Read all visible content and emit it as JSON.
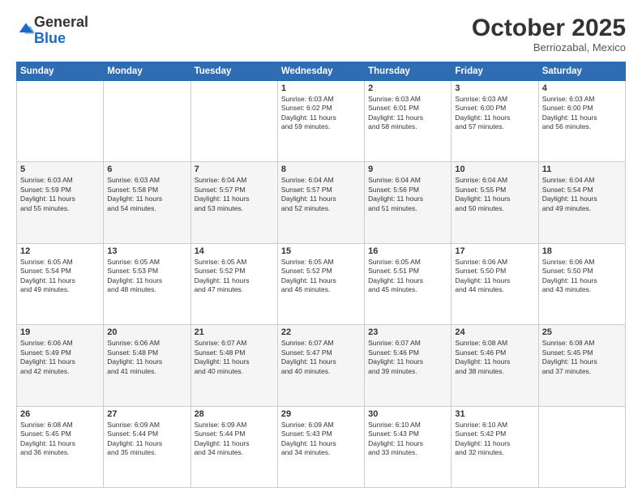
{
  "header": {
    "logo_general": "General",
    "logo_blue": "Blue",
    "month": "October 2025",
    "location": "Berriozabal, Mexico"
  },
  "days_of_week": [
    "Sunday",
    "Monday",
    "Tuesday",
    "Wednesday",
    "Thursday",
    "Friday",
    "Saturday"
  ],
  "weeks": [
    [
      {
        "day": "",
        "info": ""
      },
      {
        "day": "",
        "info": ""
      },
      {
        "day": "",
        "info": ""
      },
      {
        "day": "1",
        "info": "Sunrise: 6:03 AM\nSunset: 6:02 PM\nDaylight: 11 hours\nand 59 minutes."
      },
      {
        "day": "2",
        "info": "Sunrise: 6:03 AM\nSunset: 6:01 PM\nDaylight: 11 hours\nand 58 minutes."
      },
      {
        "day": "3",
        "info": "Sunrise: 6:03 AM\nSunset: 6:00 PM\nDaylight: 11 hours\nand 57 minutes."
      },
      {
        "day": "4",
        "info": "Sunrise: 6:03 AM\nSunset: 6:00 PM\nDaylight: 11 hours\nand 56 minutes."
      }
    ],
    [
      {
        "day": "5",
        "info": "Sunrise: 6:03 AM\nSunset: 5:59 PM\nDaylight: 11 hours\nand 55 minutes."
      },
      {
        "day": "6",
        "info": "Sunrise: 6:03 AM\nSunset: 5:58 PM\nDaylight: 11 hours\nand 54 minutes."
      },
      {
        "day": "7",
        "info": "Sunrise: 6:04 AM\nSunset: 5:57 PM\nDaylight: 11 hours\nand 53 minutes."
      },
      {
        "day": "8",
        "info": "Sunrise: 6:04 AM\nSunset: 5:57 PM\nDaylight: 11 hours\nand 52 minutes."
      },
      {
        "day": "9",
        "info": "Sunrise: 6:04 AM\nSunset: 5:56 PM\nDaylight: 11 hours\nand 51 minutes."
      },
      {
        "day": "10",
        "info": "Sunrise: 6:04 AM\nSunset: 5:55 PM\nDaylight: 11 hours\nand 50 minutes."
      },
      {
        "day": "11",
        "info": "Sunrise: 6:04 AM\nSunset: 5:54 PM\nDaylight: 11 hours\nand 49 minutes."
      }
    ],
    [
      {
        "day": "12",
        "info": "Sunrise: 6:05 AM\nSunset: 5:54 PM\nDaylight: 11 hours\nand 49 minutes."
      },
      {
        "day": "13",
        "info": "Sunrise: 6:05 AM\nSunset: 5:53 PM\nDaylight: 11 hours\nand 48 minutes."
      },
      {
        "day": "14",
        "info": "Sunrise: 6:05 AM\nSunset: 5:52 PM\nDaylight: 11 hours\nand 47 minutes."
      },
      {
        "day": "15",
        "info": "Sunrise: 6:05 AM\nSunset: 5:52 PM\nDaylight: 11 hours\nand 46 minutes."
      },
      {
        "day": "16",
        "info": "Sunrise: 6:05 AM\nSunset: 5:51 PM\nDaylight: 11 hours\nand 45 minutes."
      },
      {
        "day": "17",
        "info": "Sunrise: 6:06 AM\nSunset: 5:50 PM\nDaylight: 11 hours\nand 44 minutes."
      },
      {
        "day": "18",
        "info": "Sunrise: 6:06 AM\nSunset: 5:50 PM\nDaylight: 11 hours\nand 43 minutes."
      }
    ],
    [
      {
        "day": "19",
        "info": "Sunrise: 6:06 AM\nSunset: 5:49 PM\nDaylight: 11 hours\nand 42 minutes."
      },
      {
        "day": "20",
        "info": "Sunrise: 6:06 AM\nSunset: 5:48 PM\nDaylight: 11 hours\nand 41 minutes."
      },
      {
        "day": "21",
        "info": "Sunrise: 6:07 AM\nSunset: 5:48 PM\nDaylight: 11 hours\nand 40 minutes."
      },
      {
        "day": "22",
        "info": "Sunrise: 6:07 AM\nSunset: 5:47 PM\nDaylight: 11 hours\nand 40 minutes."
      },
      {
        "day": "23",
        "info": "Sunrise: 6:07 AM\nSunset: 5:46 PM\nDaylight: 11 hours\nand 39 minutes."
      },
      {
        "day": "24",
        "info": "Sunrise: 6:08 AM\nSunset: 5:46 PM\nDaylight: 11 hours\nand 38 minutes."
      },
      {
        "day": "25",
        "info": "Sunrise: 6:08 AM\nSunset: 5:45 PM\nDaylight: 11 hours\nand 37 minutes."
      }
    ],
    [
      {
        "day": "26",
        "info": "Sunrise: 6:08 AM\nSunset: 5:45 PM\nDaylight: 11 hours\nand 36 minutes."
      },
      {
        "day": "27",
        "info": "Sunrise: 6:09 AM\nSunset: 5:44 PM\nDaylight: 11 hours\nand 35 minutes."
      },
      {
        "day": "28",
        "info": "Sunrise: 6:09 AM\nSunset: 5:44 PM\nDaylight: 11 hours\nand 34 minutes."
      },
      {
        "day": "29",
        "info": "Sunrise: 6:09 AM\nSunset: 5:43 PM\nDaylight: 11 hours\nand 34 minutes."
      },
      {
        "day": "30",
        "info": "Sunrise: 6:10 AM\nSunset: 5:43 PM\nDaylight: 11 hours\nand 33 minutes."
      },
      {
        "day": "31",
        "info": "Sunrise: 6:10 AM\nSunset: 5:42 PM\nDaylight: 11 hours\nand 32 minutes."
      },
      {
        "day": "",
        "info": ""
      }
    ]
  ]
}
